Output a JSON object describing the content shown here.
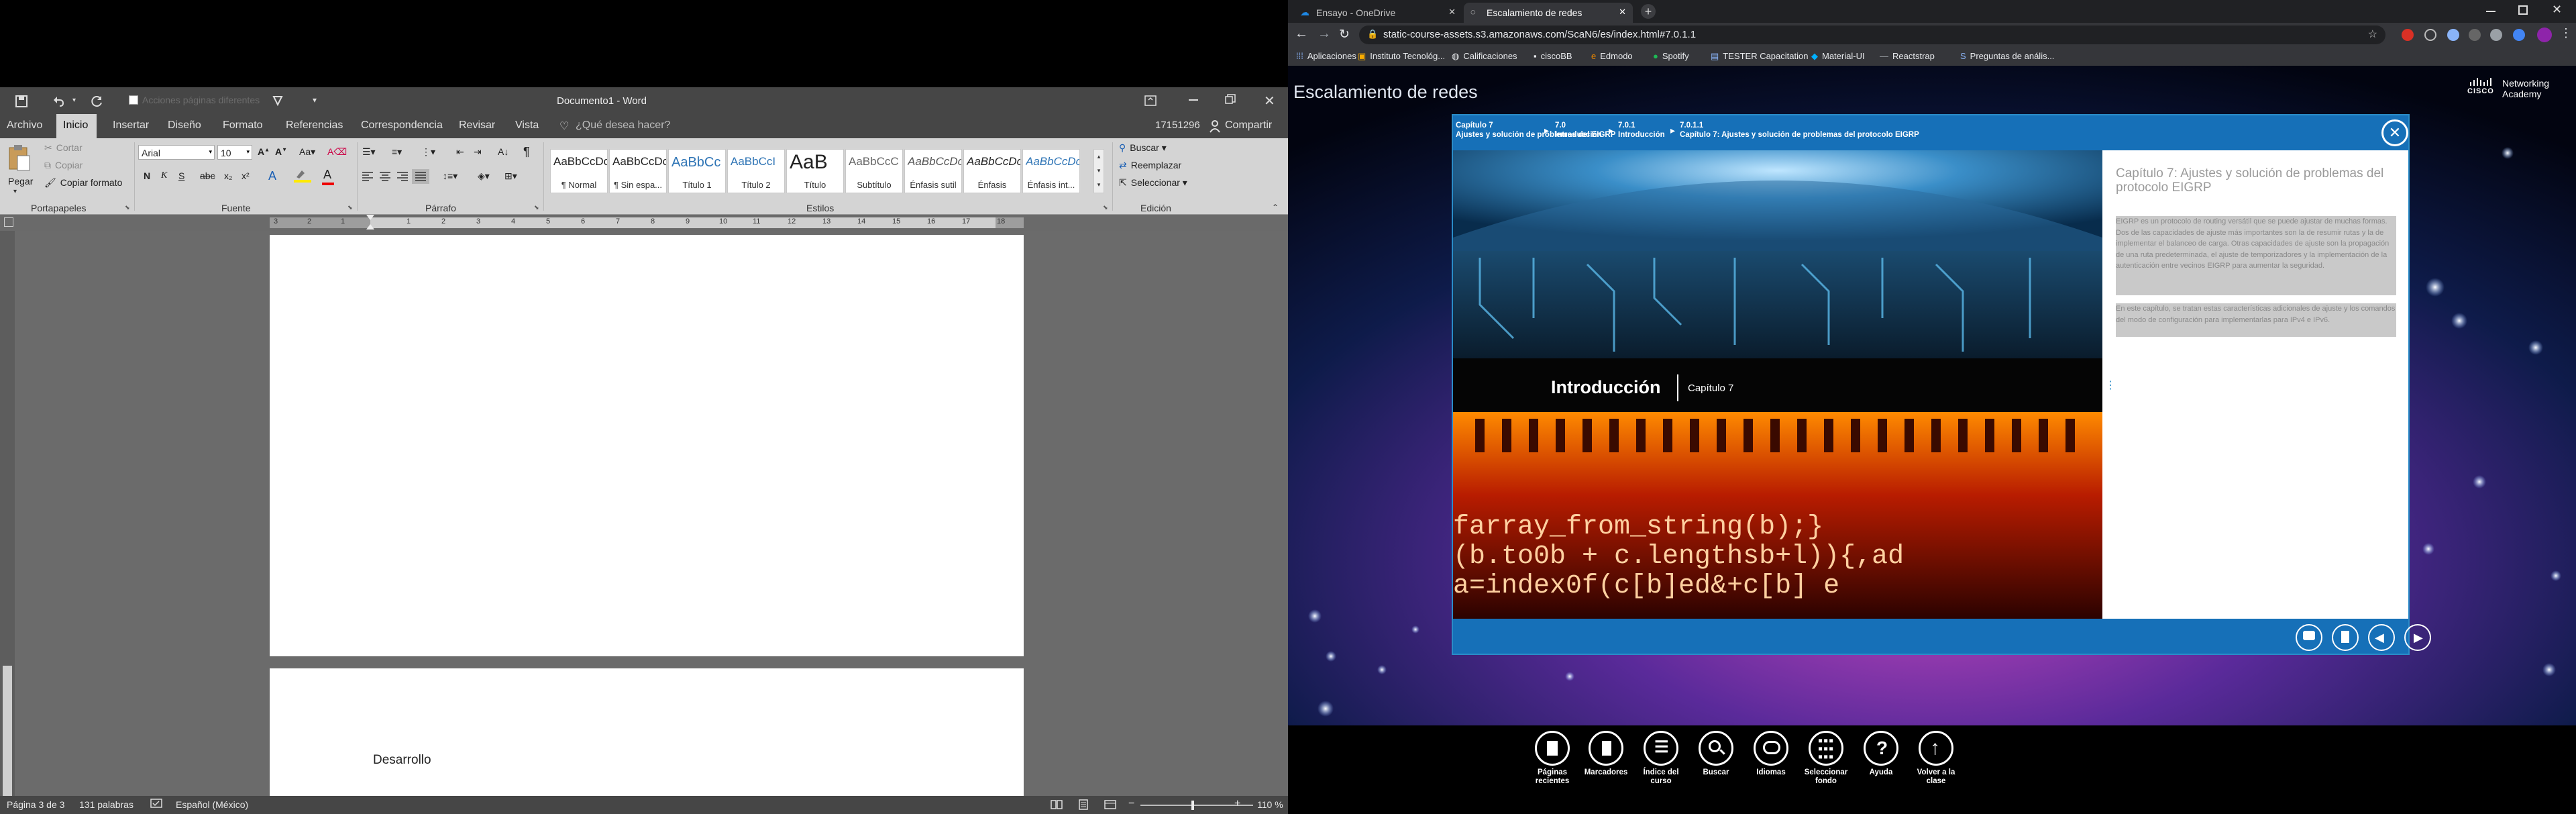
{
  "word": {
    "title": "Documento1 - Word",
    "qat_hint": "Acciones páginas diferentes",
    "tabs": [
      "Archivo",
      "Inicio",
      "Insertar",
      "Diseño",
      "Formato",
      "Referencias",
      "Correspondencia",
      "Revisar",
      "Vista"
    ],
    "active_tab": "Inicio",
    "tell_me": "¿Qué desea hacer?",
    "user": "17151296",
    "share": "Compartir",
    "clipboard": {
      "paste": "Pegar",
      "cut": "Cortar",
      "copy": "Copiar",
      "format_painter": "Copiar formato",
      "label": "Portapapeles"
    },
    "font": {
      "name": "Arial",
      "size": "10",
      "label": "Fuente"
    },
    "paragraph_label": "Párrafo",
    "styles": [
      {
        "preview": "AaBbCcDc",
        "name": "¶ Normal"
      },
      {
        "preview": "AaBbCcDc",
        "name": "¶ Sin espa..."
      },
      {
        "preview": "AaBbCc",
        "name": "Título 1"
      },
      {
        "preview": "AaBbCcI",
        "name": "Título 2"
      },
      {
        "preview": "AaB",
        "name": "Título"
      },
      {
        "preview": "AaBbCcC",
        "name": "Subtítulo"
      },
      {
        "preview": "AaBbCcDc",
        "name": "Énfasis sutil"
      },
      {
        "preview": "AaBbCcDc",
        "name": "Énfasis"
      },
      {
        "preview": "AaBbCcDc",
        "name": "Énfasis int..."
      }
    ],
    "styles_label": "Estilos",
    "editing": {
      "find": "Buscar",
      "replace": "Reemplazar",
      "select": "Seleccionar",
      "label": "Edición"
    },
    "ruler_numbers": [
      "3",
      "2",
      "1",
      "1",
      "2",
      "3",
      "4",
      "5",
      "6",
      "7",
      "8",
      "9",
      "10",
      "11",
      "12",
      "13",
      "14",
      "15",
      "16",
      "17",
      "18"
    ],
    "page2_text": "Desarrollo",
    "status": {
      "page": "Página 3 de 3",
      "words": "131 palabras",
      "language": "Español (México)",
      "zoom": "110 %"
    }
  },
  "browser": {
    "tabs": [
      {
        "title": "Ensayo - OneDrive"
      },
      {
        "title": "Escalamiento de redes"
      }
    ],
    "url": "static-course-assets.s3.amazonaws.com/ScaN6/es/index.html#7.0.1.1",
    "bookmarks": [
      "Aplicaciones",
      "Instituto Tecnológ...",
      "Calificaciones",
      "ciscoBB",
      "Edmodo",
      "Spotify",
      "TESTER Capacitation",
      "Material-UI",
      "Reactstrap",
      "Preguntas de anális..."
    ],
    "course_title": "Escalamiento de redes",
    "cisco_logo": "CISCO",
    "academy_line1": "Networking",
    "academy_line2": "Academy",
    "breadcrumbs": [
      {
        "top": "Capítulo 7",
        "bottom": "Ajustes y solución de problemas del EIGRP"
      },
      {
        "top": "7.0",
        "bottom": "Introducción"
      },
      {
        "top": "7.0.1",
        "bottom": "Introducción"
      },
      {
        "top": "7.0.1.1",
        "bottom": "Capítulo 7: Ajustes y solución de problemas del protocolo EIGRP"
      }
    ],
    "banner_title": "Introducción",
    "banner_sub": "Capítulo 7",
    "code_line1": "farray_from_string(b);}",
    "code_line2": "(b.to0b + c.lengthsb+l)){,ad",
    "code_line3": "a=index0f(c[b]ed&+c[b] e",
    "heading": "Capítulo 7: Ajustes y solución de problemas del protocolo EIGRP",
    "para1": "EIGRP es un protocolo de routing versátil que se puede ajustar de muchas formas. Dos de las capacidades de ajuste más importantes son la de resumir rutas y la de implementar el balanceo de carga. Otras capacidades de ajuste son la propagación de una ruta predeterminada, el ajuste de temporizadores y la implementación de la autenticación entre vecinos EIGRP para aumentar la seguridad.",
    "para2": "En este capítulo, se tratan estas características adicionales de ajuste y los comandos del modo de configuración para implementarlas para IPv4 e IPv6.",
    "bottom_nav": [
      {
        "icon": "pages-icon",
        "label": "Páginas recientes"
      },
      {
        "icon": "bookmark-icon",
        "label": "Marcadores"
      },
      {
        "icon": "index-icon",
        "label": "Índice del curso"
      },
      {
        "icon": "search-icon",
        "label": "Buscar"
      },
      {
        "icon": "language-icon",
        "label": "Idiomas"
      },
      {
        "icon": "grid-icon",
        "label": "Seleccionar fondo"
      },
      {
        "icon": "help-icon",
        "label": "Ayuda"
      },
      {
        "icon": "up-arrow-icon",
        "label": "Volver a la clase"
      }
    ]
  }
}
